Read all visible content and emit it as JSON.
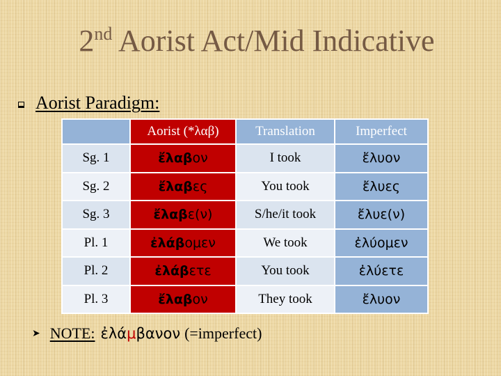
{
  "title": {
    "ordinal": "2",
    "ordinal_suffix": "nd",
    "text": "Aorist Act/Mid Indicative"
  },
  "subheading": {
    "bullet_icon": "square-bullet-icon",
    "text": "Aorist Paradigm:"
  },
  "table": {
    "headers": [
      "",
      "Aorist (*λαβ)",
      "Translation",
      "Imperfect"
    ],
    "rows": [
      {
        "label": "Sg. 1",
        "aorist_stem": "ἔλαβ",
        "aorist_ending": "ον",
        "translation": "I took",
        "imperfect": "ἔλυον"
      },
      {
        "label": "Sg. 2",
        "aorist_stem": "ἔλαβ",
        "aorist_ending": "ες",
        "translation": "You took",
        "imperfect": "ἔλυες"
      },
      {
        "label": "Sg. 3",
        "aorist_stem": "ἔλαβ",
        "aorist_ending": "ε(ν)",
        "translation": "S/he/it took",
        "imperfect": "ἔλυε(ν)"
      },
      {
        "label": "Pl. 1",
        "aorist_stem": "ἐλάβ",
        "aorist_ending": "ομεν",
        "translation": "We took",
        "imperfect": "ἐλύομεν"
      },
      {
        "label": "Pl. 2",
        "aorist_stem": "ἐλάβ",
        "aorist_ending": "ετε",
        "translation": "You took",
        "imperfect": "ἐλύετε"
      },
      {
        "label": "Pl. 3",
        "aorist_stem": "ἔλαβ",
        "aorist_ending": "ον",
        "translation": "They took",
        "imperfect": "ἔλυον"
      }
    ]
  },
  "note": {
    "bullet_icon": "arrow-bullet-icon",
    "label": "NOTE:",
    "greek_before": "ἐλά",
    "greek_highlight": "μ",
    "greek_after": "βανον",
    "paren": "(=imperfect)"
  },
  "colors": {
    "title": "#755a44",
    "aorist_column": "#c00000",
    "header_blue": "#95b3d7",
    "row_light": "#edf1f7",
    "row_mid": "#dbe4ef",
    "highlight": "#c00000"
  }
}
